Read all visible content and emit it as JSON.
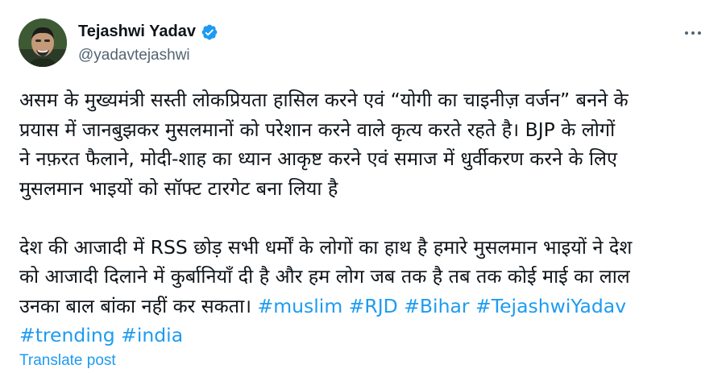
{
  "author": {
    "display_name": "Tejashwi Yadav",
    "handle": "@yadavtejashwi",
    "verified": true,
    "verified_color": "#1d9bf0"
  },
  "menu": {
    "icon": "more-horizontal-icon"
  },
  "post": {
    "paragraph1": [
      "असम के मुख्यमंत्री सस्ती लोकप्रियता हासिल करने एवं “योगी का चाइनीज़ वर्जन” बनने के",
      "प्रयास में जानबुझकर मुसलमानों को परेशान करने वाले कृत्य करते रहते है। BJP के लोगों",
      "ने नफ़रत फैलाने, मोदी-शाह का ध्यान आकृष्ट करने एवं समाज में धुर्वीकरण करने के लिए",
      "मुसलमान भाइयों को सॉफ्ट टारगेट बना लिया है"
    ],
    "paragraph2": [
      "देश की आजादी में RSS छोड़ सभी धर्मों के लोगों का हाथ है हमारे मुसलमान भाइयों ने देश",
      "को आजादी दिलाने में कुर्बानियाँ दी है और हम लोग जब तक है तब तक कोई माई का लाल",
      "उनका बाल बांका नहीं कर सकता। "
    ],
    "hashtags": [
      "#muslim",
      "#RJD",
      "#Bihar",
      "#TejashwiYadav",
      "#trending",
      "#india"
    ],
    "hashtag_color": "#1d9bf0"
  },
  "translate_label": "Translate post"
}
